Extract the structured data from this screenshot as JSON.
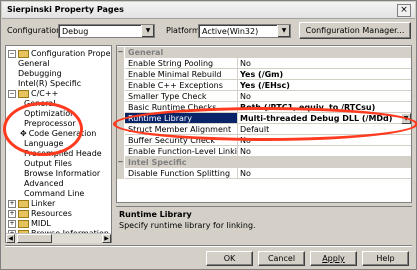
{
  "window": {
    "title": "Sierpinski Property Pages",
    "close_glyph": "×"
  },
  "toolbar": {
    "configuration_label": "Configuration:",
    "configuration_value": "Debug",
    "platform_label": "Platform:",
    "platform_value": "Active(Win32)",
    "config_manager_label": "Configuration Manager..."
  },
  "tree": {
    "items": [
      {
        "label": "Configuration Properties",
        "expander": "−",
        "icon": "folder-icon"
      },
      {
        "label": "General"
      },
      {
        "label": "Debugging"
      },
      {
        "label": "Intel(R) Specific"
      },
      {
        "label": "C/C++",
        "expander": "−",
        "icon": "folder-icon"
      },
      {
        "label": "General"
      },
      {
        "label": "Optimization"
      },
      {
        "label": "Preprocessor"
      },
      {
        "label": "Code Generation",
        "icon": "pointer-icon"
      },
      {
        "label": "Language"
      },
      {
        "label": "Precompiled Heade"
      },
      {
        "label": "Output Files"
      },
      {
        "label": "Browse Informatior"
      },
      {
        "label": "Advanced"
      },
      {
        "label": "Command Line"
      },
      {
        "label": "Linker",
        "expander": "+",
        "icon": "folder-icon"
      },
      {
        "label": "Resources",
        "expander": "+",
        "icon": "folder-icon"
      },
      {
        "label": "MIDL",
        "expander": "+",
        "icon": "folder-icon"
      },
      {
        "label": "Browse Information",
        "expander": "+",
        "icon": "folder-icon"
      }
    ]
  },
  "grid": {
    "sections": [
      {
        "category": "General",
        "collapse": "−"
      },
      {
        "name": "Enable String Pooling",
        "value": "No"
      },
      {
        "name": "Enable Minimal Rebuild",
        "value": "Yes (/Gm)",
        "bold": true
      },
      {
        "name": "Enable C++ Exceptions",
        "value": "Yes (/EHsc)",
        "bold": true
      },
      {
        "name": "Smaller Type Check",
        "value": "No"
      },
      {
        "name": "Basic Runtime Checks",
        "value": "Both (/RTC1, equiv. to /RTCsu)",
        "bold": true
      },
      {
        "name": "Runtime Library",
        "value": "Multi-threaded Debug DLL (/MDd)",
        "bold": true,
        "selected": true
      },
      {
        "name": "Struct Member Alignment",
        "value": "Default"
      },
      {
        "name": "Buffer Security Check",
        "value": "No"
      },
      {
        "name": "Enable Function-Level Linking",
        "value": "No"
      },
      {
        "category": "Intel Specific",
        "collapse": "−"
      },
      {
        "name": "Disable Function Splitting",
        "value": "No"
      }
    ]
  },
  "description": {
    "title": "Runtime Library",
    "text": "Specify runtime library for linking."
  },
  "buttons": {
    "ok": "OK",
    "cancel": "Cancel",
    "apply": "Apply",
    "help": "Help"
  },
  "colors": {
    "annotation": "#ff3a1f",
    "selection": "#0a246a",
    "dialog": "#d4d0c8"
  }
}
